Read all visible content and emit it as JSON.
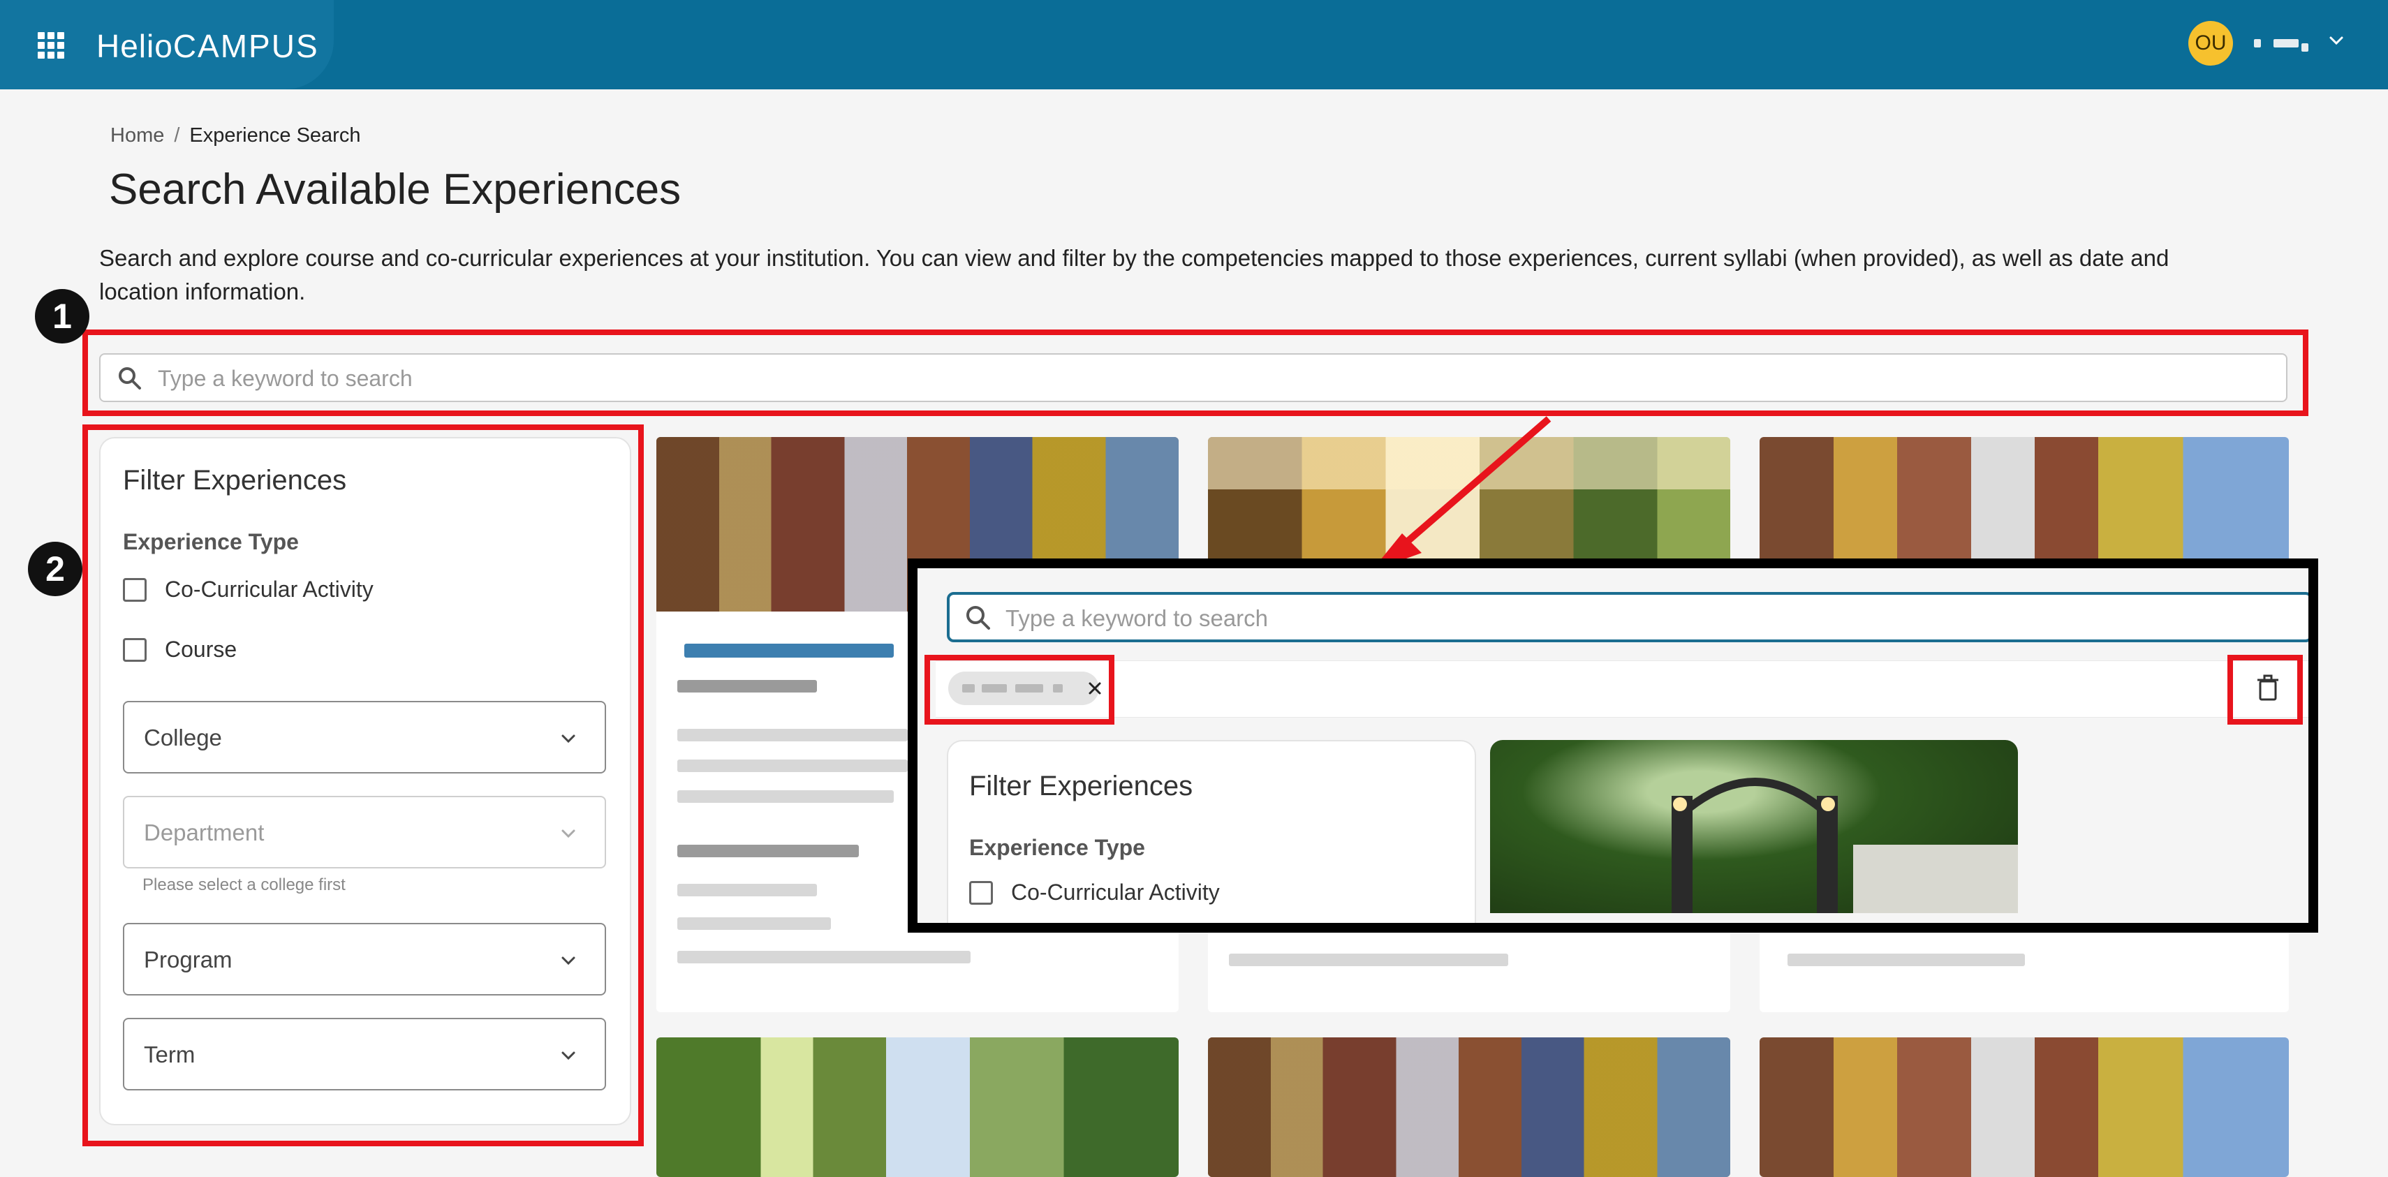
{
  "header": {
    "brand_part1": "Helio",
    "brand_part2": "CAMPUS",
    "avatar_initials": "OU",
    "apps_icon": "grid-apps-icon",
    "menu_icon": "chevron-down-icon",
    "color_primary": "#0a6d97"
  },
  "breadcrumb": {
    "home": "Home",
    "separator": "/",
    "current": "Experience Search"
  },
  "page": {
    "title": "Search Available Experiences",
    "description": "Search and explore course and co-curricular experiences at your institution. You can view and filter by the competencies mapped to those experiences, current syllabi (when provided), as well as date and location information."
  },
  "search": {
    "placeholder": "Type a keyword to search",
    "icon": "search-icon"
  },
  "filters": {
    "title": "Filter Experiences",
    "experience_type_heading": "Experience Type",
    "checkbox_cocurricular": "Co-Curricular Activity",
    "checkbox_course": "Course",
    "select_college": "College",
    "select_department": "Department",
    "department_hint": "Please select a college first",
    "select_program": "Program",
    "select_term": "Term"
  },
  "annotations": {
    "step1": "1",
    "step2": "2",
    "highlight_color": "#e8141c"
  },
  "inset": {
    "search_placeholder": "Type a keyword to search",
    "filter_title": "Filter Experiences",
    "experience_type_heading": "Experience Type",
    "checkbox_cocurricular": "Co-Curricular Activity",
    "chip_remove_icon": "close-icon",
    "clear_all_icon": "trash-icon"
  }
}
